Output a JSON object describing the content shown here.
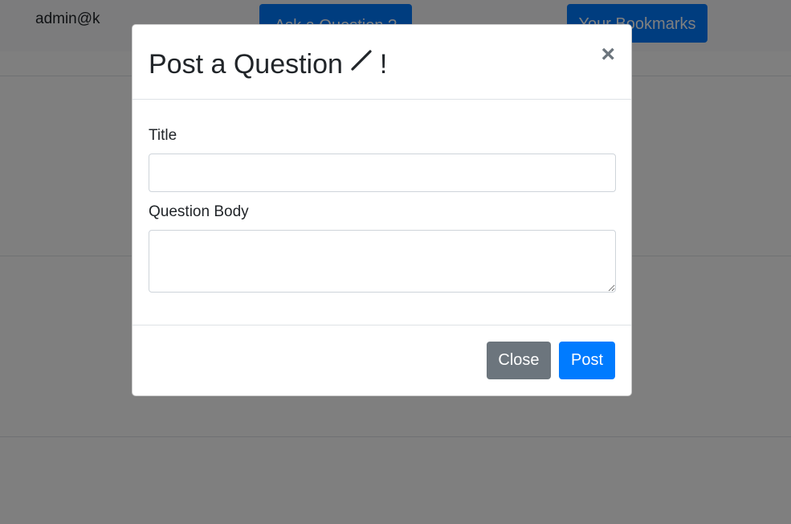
{
  "navbar": {
    "user": "admin@k",
    "ask_button": "Ask a Question ?",
    "bookmarks_button": "Your Bookmarks"
  },
  "modal": {
    "title": "Post a Question",
    "title_icon": "pencil-icon",
    "title_suffix": "!",
    "close_symbol": "×",
    "fields": {
      "title_label": "Title",
      "title_value": "",
      "body_label": "Question Body",
      "body_value": ""
    },
    "buttons": {
      "close_label": "Close",
      "post_label": "Post"
    }
  },
  "colors": {
    "primary": "#007bff",
    "secondary": "#6c757d",
    "backdrop": "rgba(0,0,0,0.5)"
  }
}
